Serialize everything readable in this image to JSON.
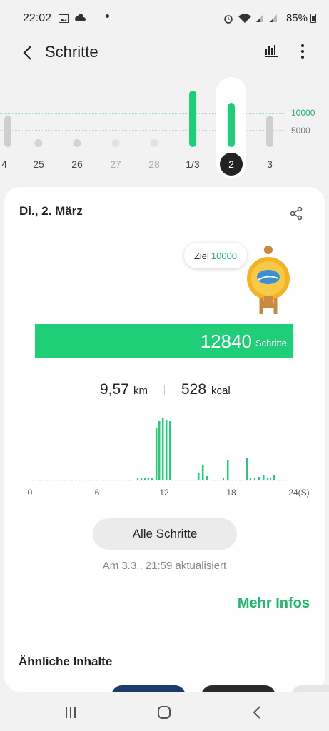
{
  "status_bar": {
    "time": "22:02",
    "battery": "85%"
  },
  "app_bar": {
    "title": "Schritte"
  },
  "week": {
    "days": [
      "4",
      "25",
      "26",
      "27",
      "28",
      "1/3",
      "2",
      "3"
    ],
    "selected_day": "2",
    "goal_label": "10000",
    "half_label": "5000"
  },
  "card": {
    "date": "Di., 2. März",
    "goal_prefix": "Ziel",
    "goal_value": "10000",
    "steps": "12840",
    "steps_unit": "Schritte",
    "distance_value": "9,57",
    "distance_unit": "km",
    "energy_value": "528",
    "energy_unit": "kcal",
    "hourly_axis": [
      "0",
      "6",
      "12",
      "18",
      "24(S)"
    ],
    "all_steps_label": "Alle Schritte",
    "updated_text": "Am 3.3., 21:59 aktualisiert",
    "more_info_label": "Mehr Infos"
  },
  "related": {
    "title": "Ähnliche Inhalte"
  },
  "colors": {
    "accent": "#1fcf78",
    "accent_text": "#1db86a"
  }
}
